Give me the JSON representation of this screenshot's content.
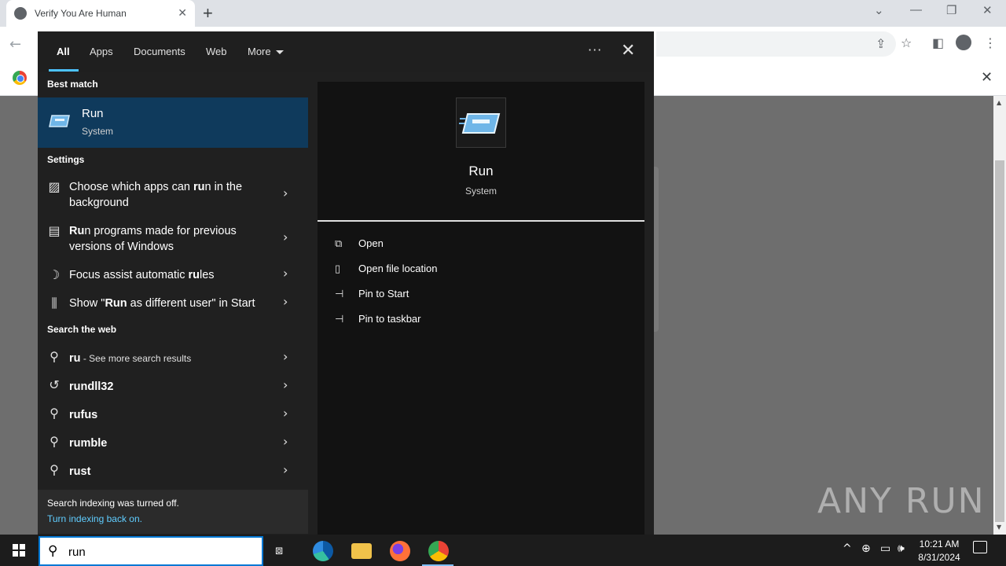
{
  "browser": {
    "tab_title": "Verify You Are Human",
    "tab_close": "✕",
    "new_tab": "+",
    "info_close": "✕"
  },
  "watermark": "ANY RUN",
  "search_panel": {
    "filters": [
      "All",
      "Apps",
      "Documents",
      "Web",
      "More"
    ],
    "more_options": "···",
    "close": "✕",
    "best_match_heading": "Best match",
    "best_match": {
      "name": "Run",
      "subtitle": "System"
    },
    "settings_heading": "Settings",
    "settings": [
      {
        "pre": "Choose which apps can ",
        "bold": "ru",
        "post": "n in the background"
      },
      {
        "pre": "",
        "bold": "Ru",
        "post": "n programs made for previous versions of Windows"
      },
      {
        "pre": "Focus assist automatic ",
        "bold": "ru",
        "post": "les"
      },
      {
        "pre": "Show \"",
        "bold": "Run",
        "post": " as different user\" in Start"
      }
    ],
    "web_heading": "Search the web",
    "web_results": [
      {
        "term": "ru",
        "suffix": " - See more search results"
      },
      {
        "term": "rundll32",
        "suffix": ""
      },
      {
        "term": "rufus",
        "suffix": ""
      },
      {
        "term": "rumble",
        "suffix": ""
      },
      {
        "term": "rust",
        "suffix": ""
      }
    ],
    "footer": {
      "notice": "Search indexing was turned off.",
      "link": "Turn indexing back on."
    },
    "preview": {
      "name": "Run",
      "subtitle": "System",
      "actions": [
        "Open",
        "Open file location",
        "Pin to Start",
        "Pin to taskbar"
      ]
    }
  },
  "taskbar": {
    "search_value": "run",
    "time": "10:21 AM",
    "date": "8/31/2024"
  },
  "colors": {
    "accent": "#0078d4",
    "selected": "#0f3a5c",
    "link": "#60cdff"
  }
}
